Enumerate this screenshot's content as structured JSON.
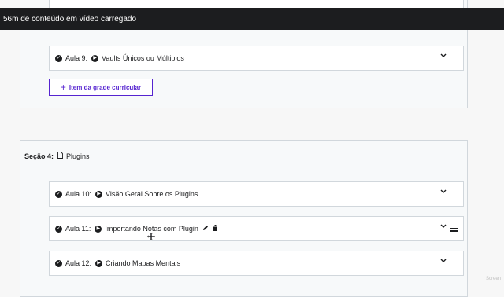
{
  "toast": {
    "text": "56m de conteúdo em vídeo carregado"
  },
  "section3": {
    "lecture9": {
      "number": "Aula 9:",
      "title": "Vaults Únicos ou Múltiplos"
    },
    "add_button": {
      "label": "Item da grade curricular"
    }
  },
  "section4": {
    "label": "Seção 4:",
    "title": "Plugins",
    "lectures": [
      {
        "number": "Aula 10:",
        "title": "Visão Geral Sobre os Plugins"
      },
      {
        "number": "Aula 11:",
        "title": "Importando Notas com Plugin"
      },
      {
        "number": "Aula 12:",
        "title": "Criando Mapas Mentais"
      }
    ]
  },
  "watermark": "Screen",
  "colors": {
    "accent": "#5624d0",
    "toast_bg": "#1c1d1f",
    "border": "#d1d7dc"
  },
  "icons": [
    "check-circle-icon",
    "play-icon",
    "chevron-down-icon",
    "file-icon",
    "pencil-icon",
    "trash-icon",
    "hamburger-icon",
    "plus-icon",
    "move-cursor-icon"
  ]
}
